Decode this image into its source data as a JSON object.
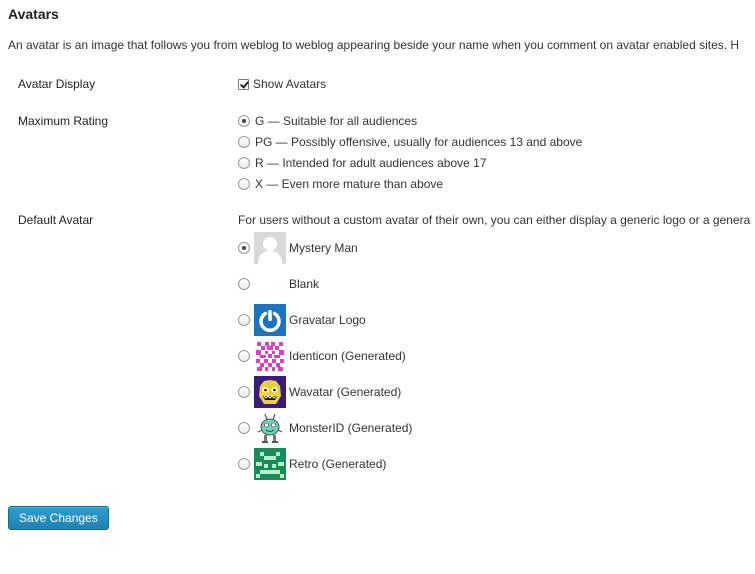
{
  "section": {
    "title": "Avatars",
    "intro": "An avatar is an image that follows you from weblog to weblog appearing beside your name when you comment on avatar enabled sites. H"
  },
  "avatar_display": {
    "label": "Avatar Display",
    "checkbox_label": "Show Avatars",
    "checked": true
  },
  "maximum_rating": {
    "label": "Maximum Rating",
    "options": [
      {
        "label": "G — Suitable for all audiences",
        "checked": true
      },
      {
        "label": "PG — Possibly offensive, usually for audiences 13 and above",
        "checked": false
      },
      {
        "label": "R — Intended for adult audiences above 17",
        "checked": false
      },
      {
        "label": "X — Even more mature than above",
        "checked": false
      }
    ]
  },
  "default_avatar": {
    "label": "Default Avatar",
    "description": "For users without a custom avatar of their own, you can either display a generic logo or a genera",
    "options": [
      {
        "label": "Mystery Man",
        "icon": "mystery-man-avatar-icon",
        "checked": true
      },
      {
        "label": "Blank",
        "icon": "blank-avatar-icon",
        "checked": false
      },
      {
        "label": "Gravatar Logo",
        "icon": "gravatar-logo-icon",
        "checked": false
      },
      {
        "label": "Identicon (Generated)",
        "icon": "identicon-avatar-icon",
        "checked": false
      },
      {
        "label": "Wavatar (Generated)",
        "icon": "wavatar-avatar-icon",
        "checked": false
      },
      {
        "label": "MonsterID (Generated)",
        "icon": "monsterid-avatar-icon",
        "checked": false
      },
      {
        "label": "Retro (Generated)",
        "icon": "retro-avatar-icon",
        "checked": false
      }
    ]
  },
  "save_button": {
    "label": "Save Changes"
  },
  "colors": {
    "button_primary": "#2181b1",
    "gravatar_blue": "#1e73be",
    "identicon_pink": "#e040c0",
    "wavatar_purple": "#3a1a7a",
    "retro_green": "#1a8a5a"
  }
}
